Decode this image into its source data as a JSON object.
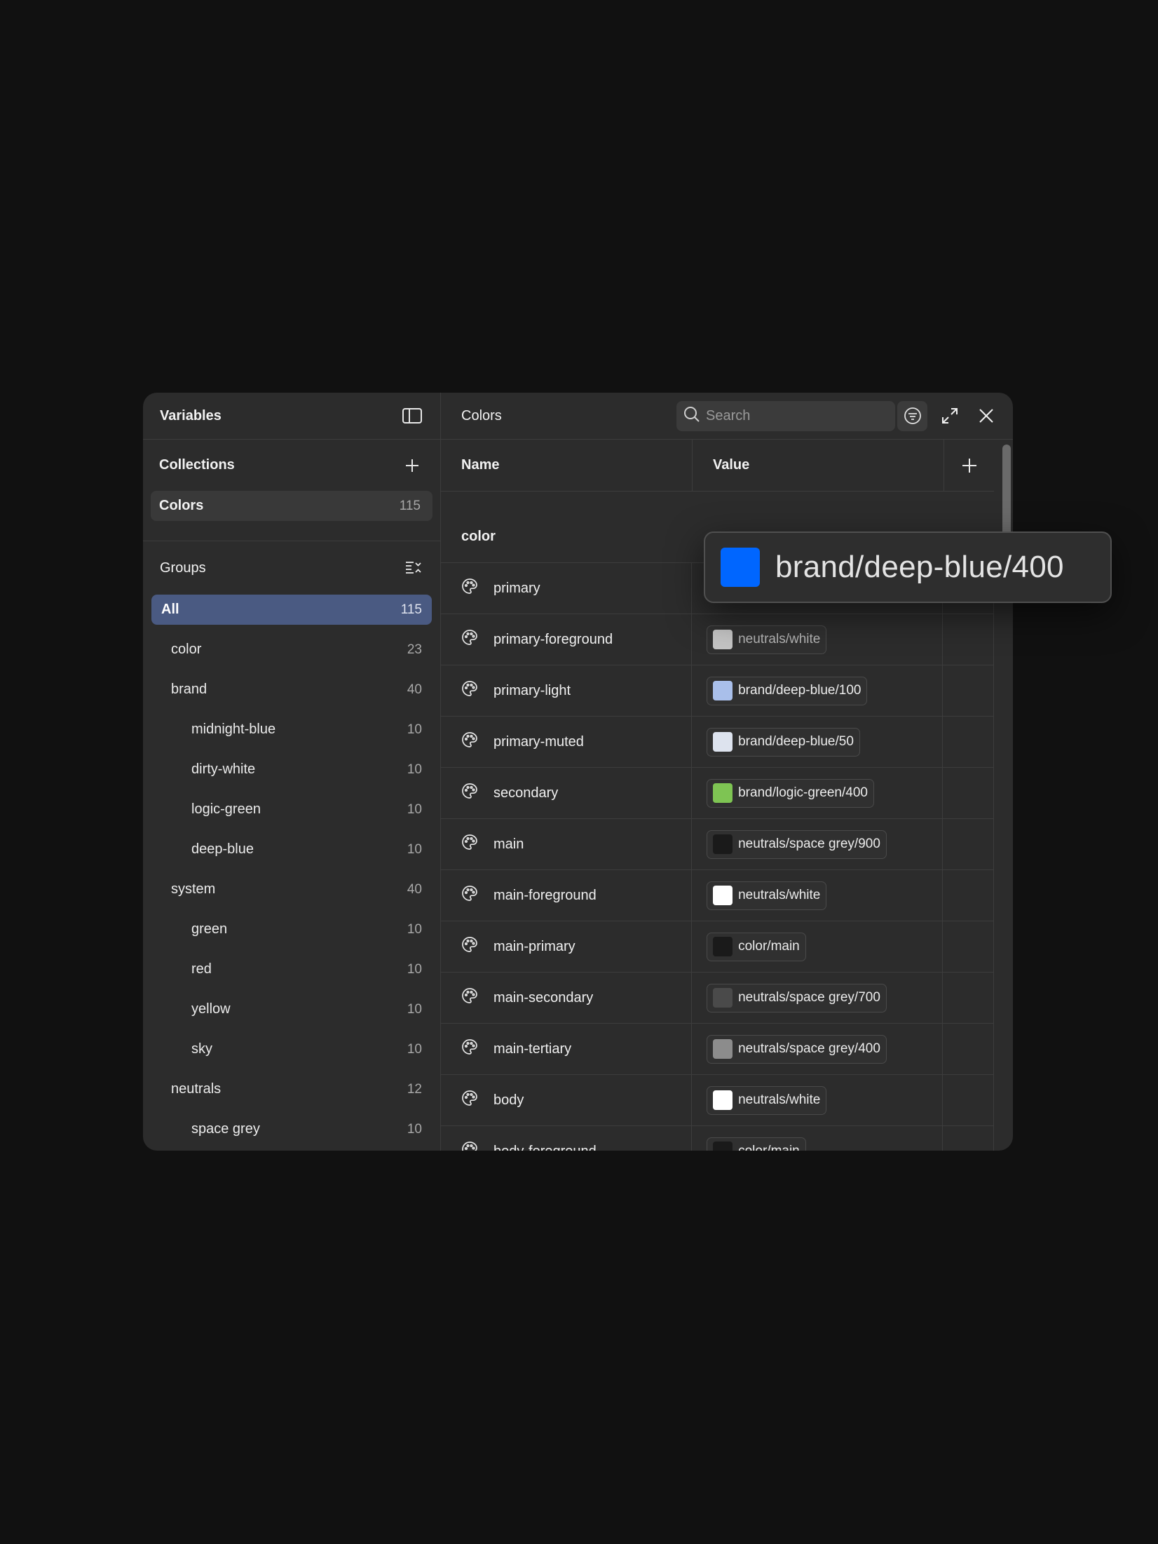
{
  "sidebar": {
    "title": "Variables",
    "collections_title": "Collections",
    "collections": [
      {
        "label": "Colors",
        "count": "115"
      }
    ],
    "groups_title": "Groups",
    "groups": [
      {
        "label": "All",
        "count": "115",
        "level": 0,
        "active": true
      },
      {
        "label": "color",
        "count": "23",
        "level": 1
      },
      {
        "label": "brand",
        "count": "40",
        "level": 1
      },
      {
        "label": "midnight-blue",
        "count": "10",
        "level": 2
      },
      {
        "label": "dirty-white",
        "count": "10",
        "level": 2
      },
      {
        "label": "logic-green",
        "count": "10",
        "level": 2
      },
      {
        "label": "deep-blue",
        "count": "10",
        "level": 2
      },
      {
        "label": "system",
        "count": "40",
        "level": 1
      },
      {
        "label": "green",
        "count": "10",
        "level": 2
      },
      {
        "label": "red",
        "count": "10",
        "level": 2
      },
      {
        "label": "yellow",
        "count": "10",
        "level": 2
      },
      {
        "label": "sky",
        "count": "10",
        "level": 2
      },
      {
        "label": "neutrals",
        "count": "12",
        "level": 1
      },
      {
        "label": "space grey",
        "count": "10",
        "level": 2
      }
    ]
  },
  "main": {
    "title": "Colors",
    "search_placeholder": "Search",
    "columns": {
      "name": "Name",
      "value": "Value"
    },
    "group_label": "color",
    "rows": [
      {
        "name": "primary",
        "value": "",
        "swatch": ""
      },
      {
        "name": "primary-foreground",
        "value": "neutrals/white",
        "swatch": "#c4c4c4",
        "dim": true
      },
      {
        "name": "primary-light",
        "value": "brand/deep-blue/100",
        "swatch": "#a9bfea"
      },
      {
        "name": "primary-muted",
        "value": "brand/deep-blue/50",
        "swatch": "#dde3ee"
      },
      {
        "name": "secondary",
        "value": "brand/logic-green/400",
        "swatch": "#7ec453"
      },
      {
        "name": "main",
        "value": "neutrals/space grey/900",
        "swatch": "#1a1a1a"
      },
      {
        "name": "main-foreground",
        "value": "neutrals/white",
        "swatch": "#ffffff"
      },
      {
        "name": "main-primary",
        "value": "color/main",
        "swatch": "#1a1a1a"
      },
      {
        "name": "main-secondary",
        "value": "neutrals/space grey/700",
        "swatch": "#4a4a4a"
      },
      {
        "name": "main-tertiary",
        "value": "neutrals/space grey/400",
        "swatch": "#8c8c8c"
      },
      {
        "name": "body",
        "value": "neutrals/white",
        "swatch": "#ffffff"
      },
      {
        "name": "body-foreground",
        "value": "color/main",
        "swatch": "#1a1a1a"
      }
    ]
  },
  "tooltip": {
    "label": "brand/deep-blue/400",
    "swatch": "#0066ff"
  }
}
